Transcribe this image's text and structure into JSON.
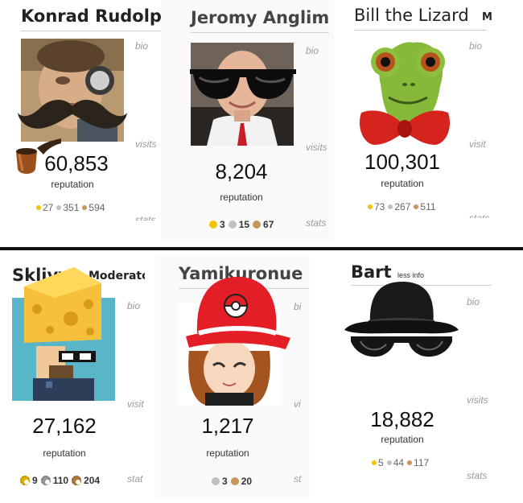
{
  "cards": [
    {
      "name": "Konrad Rudolph",
      "rep": "60,853",
      "rep_label": "reputation",
      "gold": "27",
      "silver": "351",
      "bronze": "594",
      "bio": "bio",
      "visits": "visits",
      "stats": "stats"
    },
    {
      "name": "Jeromy Anglim",
      "rep": "8,204",
      "rep_label": "reputation",
      "gold": "3",
      "silver": "15",
      "bronze": "67",
      "bio": "bio",
      "visits": "visits",
      "stats": "stats"
    },
    {
      "name": "Bill the Lizard",
      "rep": "100,301",
      "rep_label": "reputation",
      "gold": "73",
      "silver": "267",
      "bronze": "511",
      "bio": "bio",
      "visits": "visit",
      "stats": "stats",
      "extra": "M"
    },
    {
      "name": "Sklivvz",
      "badge": "Moderator",
      "rep": "27,162",
      "rep_label": "reputation",
      "gold": "9",
      "silver": "110",
      "bronze": "204",
      "bio": "bio",
      "visits": "visit",
      "stats": "stat"
    },
    {
      "name": "Yamikuronue",
      "rep": "1,217",
      "rep_label": "reputation",
      "silver": "3",
      "bronze": "20",
      "bio": "bi",
      "visits": "vi",
      "stats": "st"
    },
    {
      "name": "Bart",
      "less_info": "less info",
      "rep": "18,882",
      "rep_label": "reputation",
      "gold": "5",
      "silver": "44",
      "bronze": "117",
      "bio": "bio",
      "visits": "visits",
      "stats": "stats"
    }
  ],
  "icons": {
    "konrad": "magnifier-mustache-pipe-avatar",
    "jeromy": "sunglasses-avatar",
    "bill": "lizard-bowtie-avatar",
    "sklivvz": "cheese-head-pixel-avatar",
    "yamikuronue": "pokeball-cap-avatar",
    "bart": "bowler-hat-glasses-avatar"
  }
}
